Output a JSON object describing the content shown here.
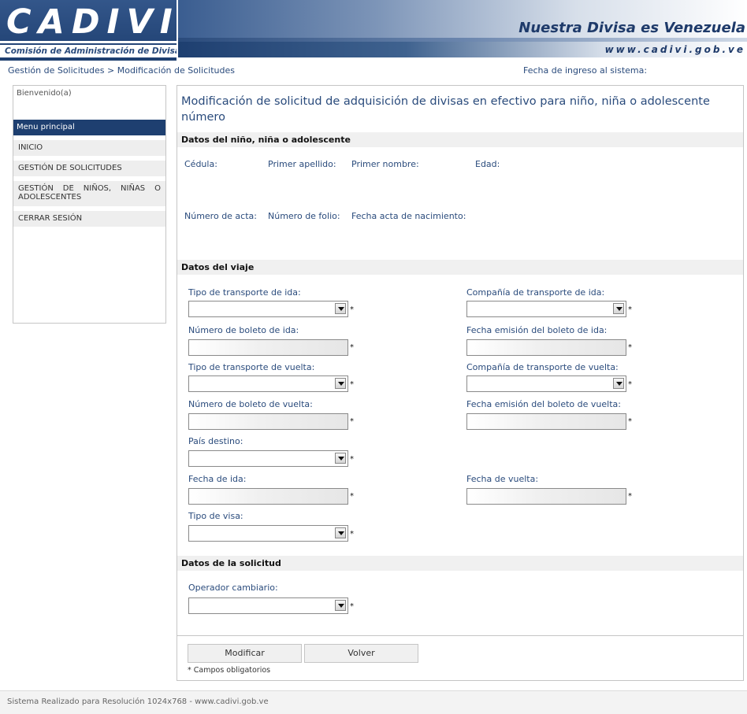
{
  "header": {
    "logo_text": "CADIVI",
    "logo_subtitle": "Comisión de Administración de Divisas",
    "slogan": "Nuestra Divisa es Venezuela",
    "url": "www.cadivi.gob.ve"
  },
  "breadcrumb": "Gestión de Solicitudes > Modificación de Solicitudes",
  "login_date_label": "Fecha de ingreso al sistema:",
  "sidebar": {
    "welcome": "Bienvenido(a)",
    "menu_title": "Menu principal",
    "items": [
      {
        "label": "INICIO"
      },
      {
        "label": "GESTIÓN DE SOLICITUDES"
      },
      {
        "label": "GESTIÓN DE NIÑOS, NIÑAS O ADOLESCENTES"
      },
      {
        "label": "CERRAR SESIÓN"
      }
    ]
  },
  "main": {
    "title": "Modificación de solicitud de adquisición de divisas en efectivo para niño, niña o adolescente número",
    "child_section": {
      "title": "Datos del niño, niña o adolescente",
      "labels": {
        "cedula": "Cédula:",
        "primer_apellido": "Primer apellido:",
        "primer_nombre": "Primer nombre:",
        "edad": "Edad:",
        "numero_acta": "Número de acta:",
        "numero_folio": "Número de folio:",
        "fecha_acta": "Fecha acta de nacimiento:"
      }
    },
    "trip_section": {
      "title": "Datos del viaje",
      "fields": {
        "tipo_ida": "Tipo de transporte de ida:",
        "compania_ida": "Compañía de transporte de ida:",
        "boleto_ida": "Número de boleto de ida:",
        "fecha_emision_ida": "Fecha emisión del boleto de ida:",
        "tipo_vuelta": "Tipo de transporte de vuelta:",
        "compania_vuelta": "Compañía de transporte de vuelta:",
        "boleto_vuelta": "Número de boleto de vuelta:",
        "fecha_emision_vuelta": "Fecha emisión del boleto de vuelta:",
        "pais_destino": "País destino:",
        "fecha_ida": "Fecha de ida:",
        "fecha_vuelta": "Fecha de vuelta:",
        "tipo_visa": "Tipo de visa:"
      }
    },
    "request_section": {
      "title": "Datos de la solicitud",
      "operador_label": "Operador cambiario:"
    },
    "required_mark": "*",
    "buttons": {
      "modify": "Modificar",
      "back": "Volver"
    },
    "required_note": "* Campos obligatorios"
  },
  "footer": "Sistema Realizado para Resolución 1024x768 - www.cadivi.gob.ve"
}
